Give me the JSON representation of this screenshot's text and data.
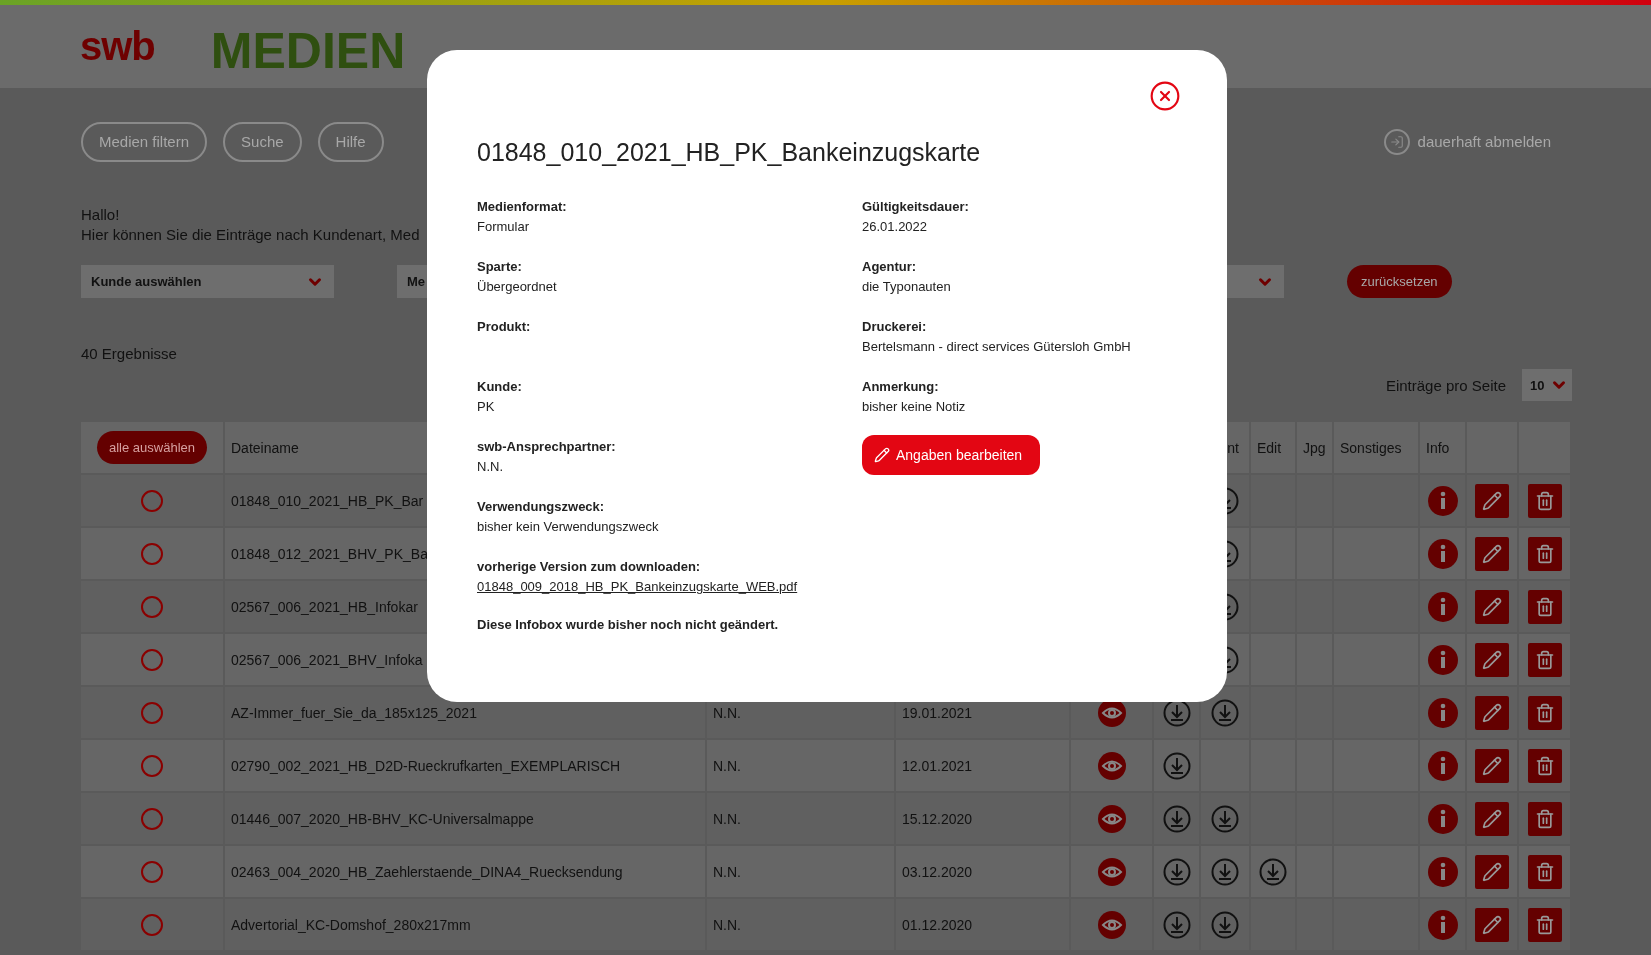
{
  "header": {
    "logo": "swb",
    "title": "MEDIEN"
  },
  "nav": {
    "buttons": [
      "Medien filtern",
      "Suche",
      "Hilfe"
    ],
    "logout": "dauerhaft abmelden"
  },
  "intro": {
    "greeting": "Hallo!",
    "text": "Hier können Sie die Einträge nach Kundenart, Med"
  },
  "filters": [
    {
      "kind": "select",
      "label": "Kunde auswählen"
    },
    {
      "kind": "select_cut",
      "label": "Me"
    },
    {
      "kind": "select"
    }
  ],
  "reset_button": "zurücksetzen",
  "results": "40 Ergebnisse",
  "per_page": {
    "label": "Einträge pro Seite",
    "value": "10"
  },
  "table": {
    "select_all": "alle auswählen",
    "columns": {
      "filename": "Dateiname",
      "column_7": "nt",
      "edit": "Edit",
      "jpg": "Jpg",
      "other": "Sonstiges",
      "info": "Info"
    },
    "rows": [
      {
        "selected": false,
        "filename": "01848_010_2021_HB_PK_Bar",
        "download_2": true,
        "download_3": false
      },
      {
        "selected": false,
        "filename": "01848_012_2021_BHV_PK_Ba",
        "download_2": true,
        "download_3": false
      },
      {
        "selected": false,
        "filename": "02567_006_2021_HB_Infokar",
        "download_2": true,
        "download_3": false
      },
      {
        "selected": false,
        "filename": "02567_006_2021_BHV_Infoka",
        "download_2": true,
        "download_3": false
      },
      {
        "selected": false,
        "filename": "AZ-Immer_fuer_Sie_da_185x125_2021",
        "contact": "N.N.",
        "date": "19.01.2021",
        "preview": true,
        "download_1": true,
        "download_2": true,
        "download_3": false
      },
      {
        "selected": false,
        "filename": "02790_002_2021_HB_D2D-Rueckrufkarten_EXEMPLARISCH",
        "contact": "N.N.",
        "date": "12.01.2021",
        "preview": true,
        "download_1": true,
        "download_2": false,
        "download_3": false
      },
      {
        "selected": false,
        "filename": "01446_007_2020_HB-BHV_KC-Universalmappe",
        "contact": "N.N.",
        "date": "15.12.2020",
        "preview": true,
        "download_1": true,
        "download_2": true,
        "download_3": false
      },
      {
        "selected": false,
        "filename": "02463_004_2020_HB_Zaehlerstaende_DINA4_Ruecksendung",
        "contact": "N.N.",
        "date": "03.12.2020",
        "preview": true,
        "download_1": true,
        "download_2": true,
        "download_3": true
      },
      {
        "selected": false,
        "filename": "Advertorial_KC-Domshof_280x217mm",
        "contact": "N.N.",
        "date": "01.12.2020",
        "preview": true,
        "download_1": true,
        "download_2": true,
        "download_3": false
      }
    ]
  },
  "modal": {
    "title": "01848_010_2021_HB_PK_Bankeinzugskarte",
    "fields_left": [
      {
        "label": "Medienformat:",
        "value": "Formular"
      },
      {
        "label": "Sparte:",
        "value": "Übergeordnet"
      },
      {
        "label": "Produkt:"
      },
      {
        "label": "Kunde:",
        "value": "PK"
      },
      {
        "label": "swb-Ansprechpartner:",
        "value": "N.N."
      },
      {
        "label": "Verwendungszweck:",
        "value": "bisher kein Verwendungszweck"
      }
    ],
    "previous_version": {
      "label": "vorherige Version zum downloaden:",
      "link": "01848_009_2018_HB_PK_Bankeinzugskarte_WEB.pdf"
    },
    "note": "Diese Infobox wurde bisher noch nicht geändert.",
    "fields_right": [
      {
        "label": "Gültigkeitsdauer:",
        "value": "26.01.2022"
      },
      {
        "label": "Agentur:",
        "value": "die Typonauten"
      },
      {
        "label": "Druckerei:",
        "value": "Bertelsmann - direct services Gütersloh GmbH"
      },
      {
        "label": "Anmerkung:",
        "value": "bisher keine Notiz"
      }
    ],
    "edit_button": "Angaben bearbeiten"
  }
}
